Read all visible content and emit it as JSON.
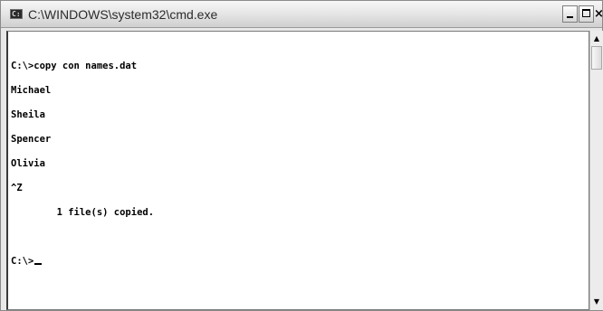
{
  "window": {
    "title": "C:\\WINDOWS\\system32\\cmd.exe",
    "icon": "console-icon",
    "controls": {
      "minimize": "minimize-icon",
      "maximize": "maximize-icon",
      "close": "×"
    }
  },
  "console": {
    "lines": [
      "C:\\>copy con names.dat",
      "Michael",
      "Sheila",
      "Spencer",
      "Olivia",
      "^Z",
      "        1 file(s) copied."
    ],
    "prompt": "C:\\>"
  },
  "scrollbar": {
    "up_arrow": "▲",
    "down_arrow": "▼"
  }
}
